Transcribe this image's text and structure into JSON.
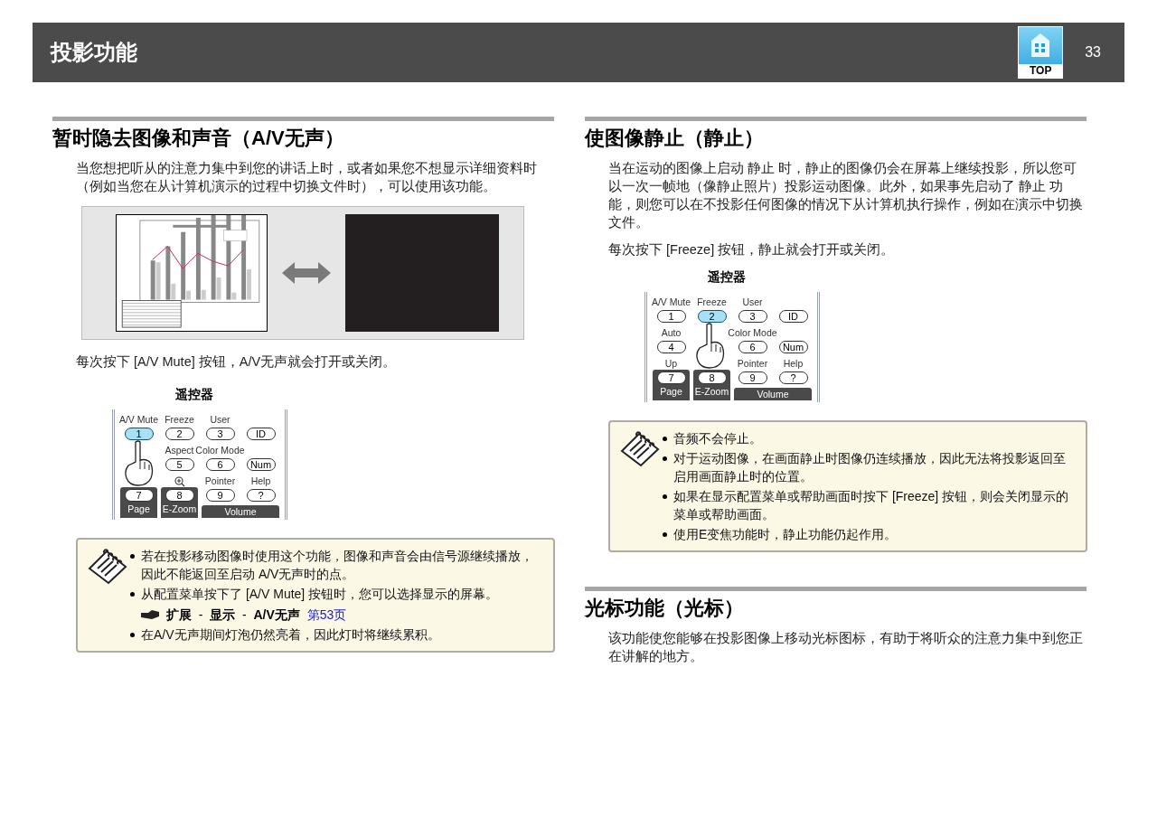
{
  "header": {
    "title": "投影功能",
    "top_label": "TOP",
    "page_number": "33"
  },
  "columns": [
    {
      "sections": [
        {
          "heading": "暂时隐去图像和声音（A/V无声）",
          "blocks": [
            {
              "kind": "paragraph",
              "text": "当您想把听从的注意力集中到您的讲话上时，或者如果您不想显示详细资料时（例如当您在从计算机演示的过程中切换文件时），可以使用该功能。"
            },
            {
              "kind": "figure"
            },
            {
              "kind": "paragraph",
              "text": "每次按下 [A/V  Mute] 按钮，A/V无声就会打开或关闭。"
            },
            {
              "kind": "remote",
              "title": "遥控器",
              "cells": [
                {
                  "kind": "text",
                  "label": "A/V Mute",
                  "key": "1",
                  "pressed": true
                },
                {
                  "kind": "text",
                  "label": "Freeze",
                  "key": "2",
                  "pressed": false
                },
                {
                  "kind": "text",
                  "label": "User",
                  "key": "3",
                  "pressed": false
                },
                {
                  "kind": "text",
                  "key": "ID",
                  "pressed": false
                },
                {
                  "kind": "text"
                },
                {
                  "kind": "text",
                  "label": "Aspect",
                  "key": "5",
                  "pressed": false
                },
                {
                  "kind": "text",
                  "label": "Color Mode",
                  "key": "6",
                  "pressed": false
                },
                {
                  "kind": "text",
                  "key": "Num",
                  "pressed": false
                },
                {
                  "kind": "text",
                  "key": "7",
                  "pressed": false
                },
                {
                  "kind": "icon",
                  "key": "8",
                  "pressed": false
                },
                {
                  "kind": "text",
                  "label": "Pointer",
                  "key": "9",
                  "pressed": false
                },
                {
                  "kind": "text",
                  "label": "Help",
                  "key": "?",
                  "pressed": false
                }
              ],
              "bottom": [
                "Page",
                "E-Zoom",
                "Volume"
              ]
            },
            {
              "kind": "note",
              "items": [
                {
                  "text": "若在投影移动图像时使用这个功能，图像和声音会由信号源继续播放，因此不能返回至启动  A/V无声时的点。"
                },
                {
                  "text": "从配置菜单按下了 [A/V  Mute] 按钮时，您可以选择显示的屏幕。",
                  "ref": {
                    "path": "**扩展**  -  **显示**  -  **A/V无声**",
                    "link": "第53页"
                  }
                },
                {
                  "text": "在A/V无声期间灯泡仍然亮着，因此灯时将继续累积。"
                }
              ]
            }
          ]
        }
      ]
    },
    {
      "sections": [
        {
          "heading": "使图像静止（静止）",
          "blocks": [
            {
              "kind": "paragraph",
              "text": "当在运动的图像上启动 静止 时，静止的图像仍会在屏幕上继续投影，所以您可以一次一帧地（像静止照片）投影运动图像。此外，如果事先启动了 静止 功能，则您可以在不投影任何图像的情况下从计算机执行操作，例如在演示中切换文件。"
            },
            {
              "kind": "paragraph",
              "text": "每次按下 [Freeze] 按钮，静止就会打开或关闭。"
            },
            {
              "kind": "remote",
              "title": "遥控器",
              "cells": [
                {
                  "kind": "text",
                  "label": "A/V Mute",
                  "key": "1",
                  "pressed": false
                },
                {
                  "kind": "text",
                  "label": "Freeze",
                  "key": "2",
                  "pressed": true
                },
                {
                  "kind": "text",
                  "label": "User",
                  "key": "3",
                  "pressed": false
                },
                {
                  "kind": "text",
                  "key": "ID",
                  "pressed": false
                },
                {
                  "kind": "text",
                  "label": "Auto",
                  "key": "4",
                  "pressed": false
                },
                {
                  "kind": "text"
                },
                {
                  "kind": "text",
                  "label": "Color Mode",
                  "key": "6",
                  "pressed": false
                },
                {
                  "kind": "text",
                  "key": "Num",
                  "pressed": false
                },
                {
                  "kind": "text",
                  "label": "Up",
                  "key": "7",
                  "pressed": false
                },
                {
                  "kind": "text",
                  "key": "8",
                  "pressed": false
                },
                {
                  "kind": "text",
                  "label": "Pointer",
                  "key": "9",
                  "pressed": false
                },
                {
                  "kind": "text",
                  "label": "Help",
                  "key": "?",
                  "pressed": false
                }
              ],
              "bottom": [
                "Page",
                "E-Zoom",
                "Volume"
              ]
            },
            {
              "kind": "note",
              "items": [
                {
                  "text": "音频不会停止。"
                },
                {
                  "text": "对于运动图像，在画面静止时图像仍连续播放，因此无法将投影返回至启用画面静止时的位置。"
                },
                {
                  "text": "如果在显示配置菜单或帮助画面时按下 [Freeze] 按钮，则会关闭显示的菜单或帮助画面。"
                },
                {
                  "text": "使用E变焦功能时，静止功能仍起作用。"
                }
              ]
            }
          ]
        },
        {
          "heading": "光标功能（光标）",
          "blocks": [
            {
              "kind": "paragraph",
              "text": "该功能使您能够在投影图像上移动光标图标，有助于将听众的注意力集中到您正在讲解的地方。"
            }
          ]
        }
      ]
    }
  ]
}
